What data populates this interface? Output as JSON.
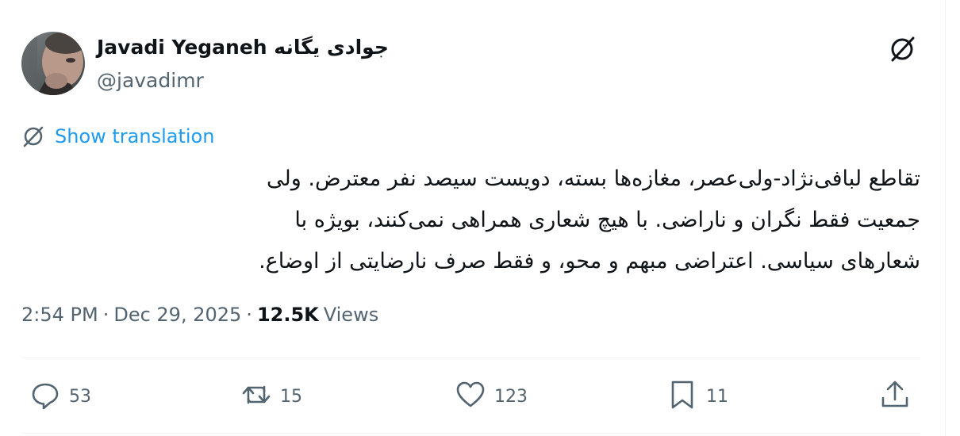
{
  "author": {
    "display_name": "Javadi Yeganeh جوادی یگانه",
    "handle": "@javadimr"
  },
  "translation": {
    "label": "Show translation"
  },
  "tweet": {
    "text_lines": [
      "تقاطع لبافی‌نژاد-ولی‌عصر، مغازه‌ها بسته، دویست سیصد نفر معترض. ولی",
      "جمعیت فقط نگران و ناراضی. با هیچ شعاری همراهی نمی‌کنند، بویژه با",
      "شعارهای سیاسی. اعتراضی مبهم و محو، و فقط صرف نارضایتی از اوضاع."
    ]
  },
  "meta": {
    "time": "2:54 PM",
    "separator": "·",
    "date": "Dec 29, 2025",
    "views_count": "12.5K",
    "views_label": "Views"
  },
  "actions": {
    "reply_count": "53",
    "retweet_count": "15",
    "like_count": "123",
    "bookmark_count": "11"
  },
  "icons": {
    "grok": "grok-icon",
    "translate": "translate-icon",
    "reply": "reply-icon",
    "retweet": "retweet-icon",
    "like": "heart-icon",
    "bookmark": "bookmark-icon",
    "share": "share-icon"
  },
  "colors": {
    "text": "#0f1419",
    "secondary": "#536471",
    "link": "#1d9bf0",
    "divider": "#eff3f4"
  }
}
